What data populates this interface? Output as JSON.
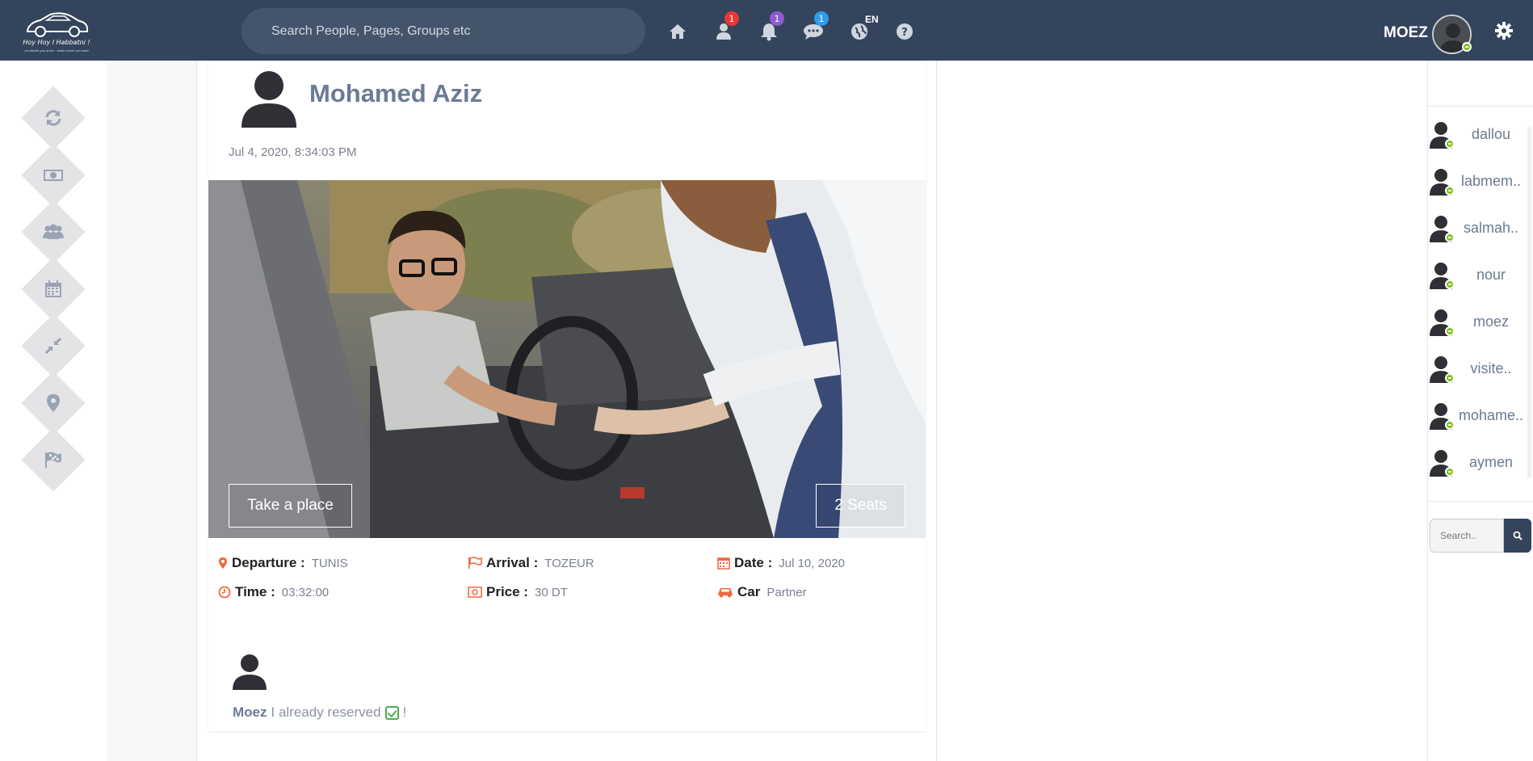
{
  "app": {
    "logo_text": "Hoy Hoy l Habbatni !",
    "logo_subtext": "on wheels you arrive . share where you want"
  },
  "topbar": {
    "search_placeholder": "Search People, Pages, Groups etc",
    "icons": [
      {
        "name": "home-icon"
      },
      {
        "name": "friends-icon",
        "badge": "1",
        "badge_color": "#e53935"
      },
      {
        "name": "notifications-icon",
        "badge": "1",
        "badge_color": "#8e5bd0"
      },
      {
        "name": "messages-icon",
        "badge": "1",
        "badge_color": "#2f9ee8"
      },
      {
        "name": "globe-icon"
      },
      {
        "name": "help-icon"
      }
    ],
    "language": "EN",
    "username": "MOEZ"
  },
  "left_sidebar": {
    "items": [
      {
        "name": "refresh-icon"
      },
      {
        "name": "money-icon"
      },
      {
        "name": "group-icon"
      },
      {
        "name": "calendar-icon"
      },
      {
        "name": "compress-icon"
      },
      {
        "name": "location-icon"
      },
      {
        "name": "flag-icon"
      }
    ]
  },
  "post": {
    "author": "Mohamed Aziz",
    "date": "Jul 4, 2020, 8:34:03 PM",
    "take_place_label": "Take a place",
    "seats_label": "2 Seats",
    "details": {
      "departure": {
        "label": "Departure :",
        "value": "TUNIS"
      },
      "arrival": {
        "label": "Arrival :",
        "value": "TOZEUR"
      },
      "date": {
        "label": "Date :",
        "value": "Jul 10, 2020"
      },
      "time": {
        "label": "Time :",
        "value": "03:32:00"
      },
      "price": {
        "label": "Price :",
        "value": "30 DT"
      },
      "car": {
        "label": "Car",
        "value": "Partner"
      }
    },
    "comment": {
      "author": "Moez",
      "text": "I already reserved",
      "suffix": "!"
    }
  },
  "contacts": [
    {
      "name": "dallou"
    },
    {
      "name": "labmem.."
    },
    {
      "name": "salmah.."
    },
    {
      "name": "nour"
    },
    {
      "name": "moez"
    },
    {
      "name": "visite.."
    },
    {
      "name": "mohame.."
    },
    {
      "name": "aymen"
    }
  ],
  "chat_search": {
    "placeholder": "Search.."
  },
  "colors": {
    "nav_bg": "#34445c",
    "accent_orange": "#f0673e",
    "online": "#7cc31c"
  }
}
